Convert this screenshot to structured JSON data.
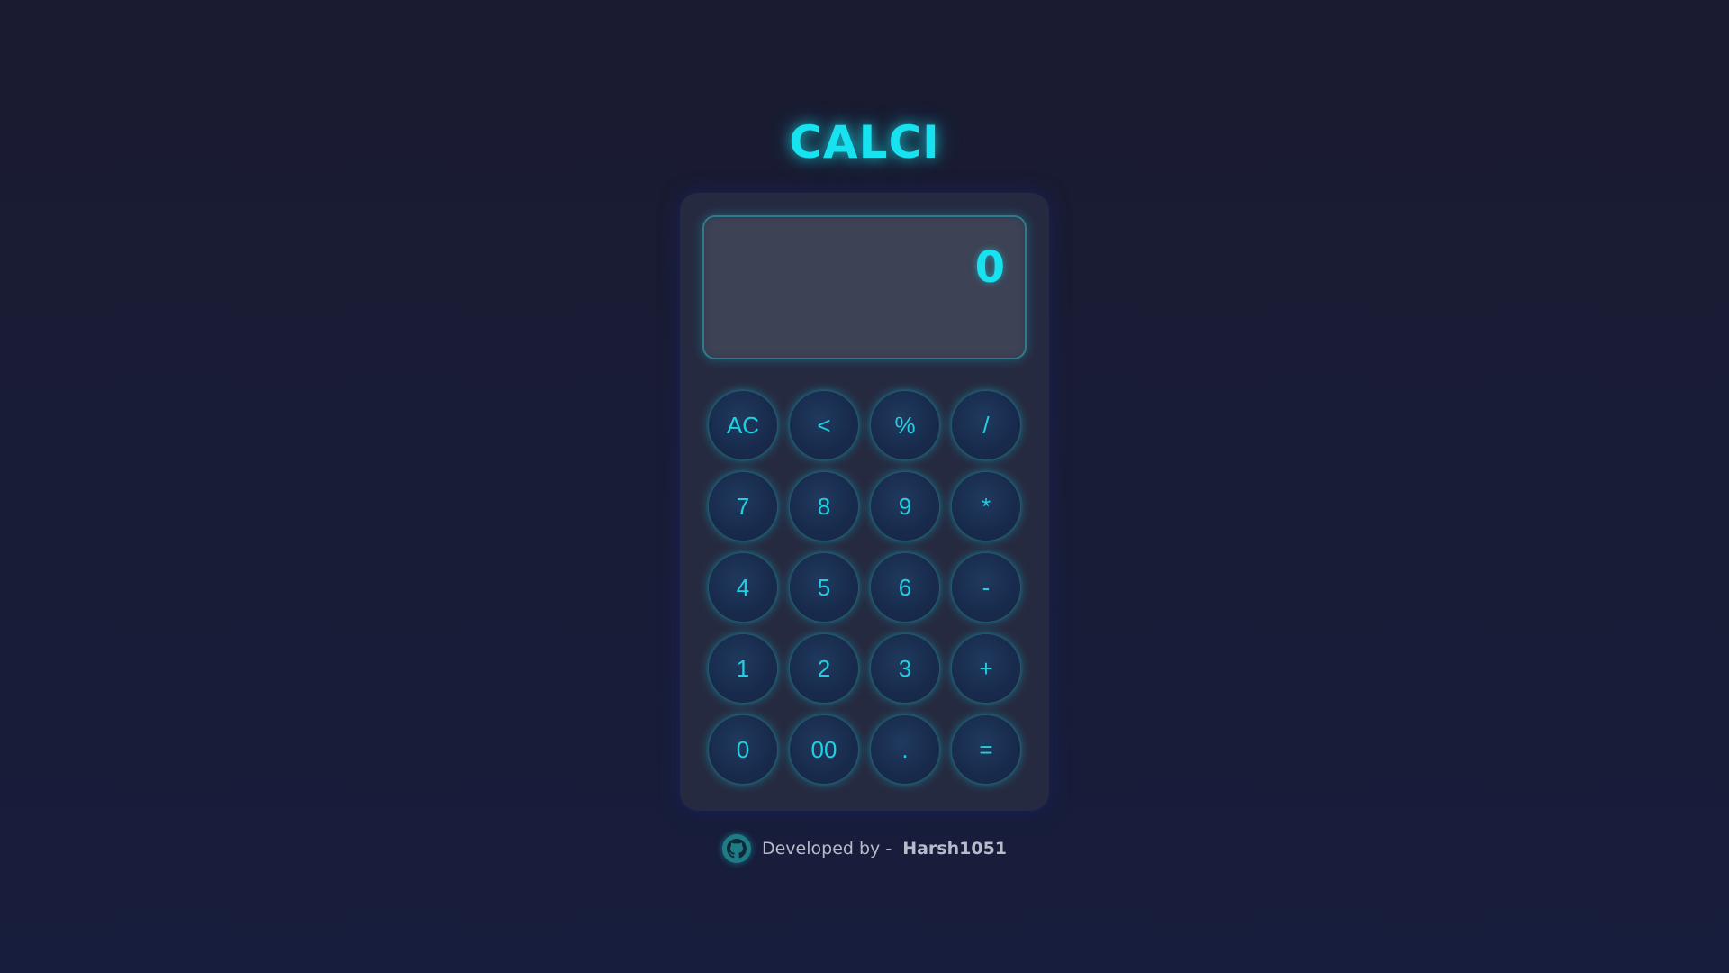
{
  "app": {
    "title": "CALCI",
    "accent_color": "#18e2ef",
    "background_color": "#1a1c33"
  },
  "display": {
    "value": "0"
  },
  "keypad": {
    "keys": [
      {
        "label": "AC"
      },
      {
        "label": "<"
      },
      {
        "label": "%"
      },
      {
        "label": "/"
      },
      {
        "label": "7"
      },
      {
        "label": "8"
      },
      {
        "label": "9"
      },
      {
        "label": "*"
      },
      {
        "label": "4"
      },
      {
        "label": "5"
      },
      {
        "label": "6"
      },
      {
        "label": "-"
      },
      {
        "label": "1"
      },
      {
        "label": "2"
      },
      {
        "label": "3"
      },
      {
        "label": "+"
      },
      {
        "label": "0"
      },
      {
        "label": "00"
      },
      {
        "label": "."
      },
      {
        "label": "="
      }
    ]
  },
  "footer": {
    "icon": "github-icon",
    "text": "Developed by -",
    "author": "Harsh1051"
  }
}
